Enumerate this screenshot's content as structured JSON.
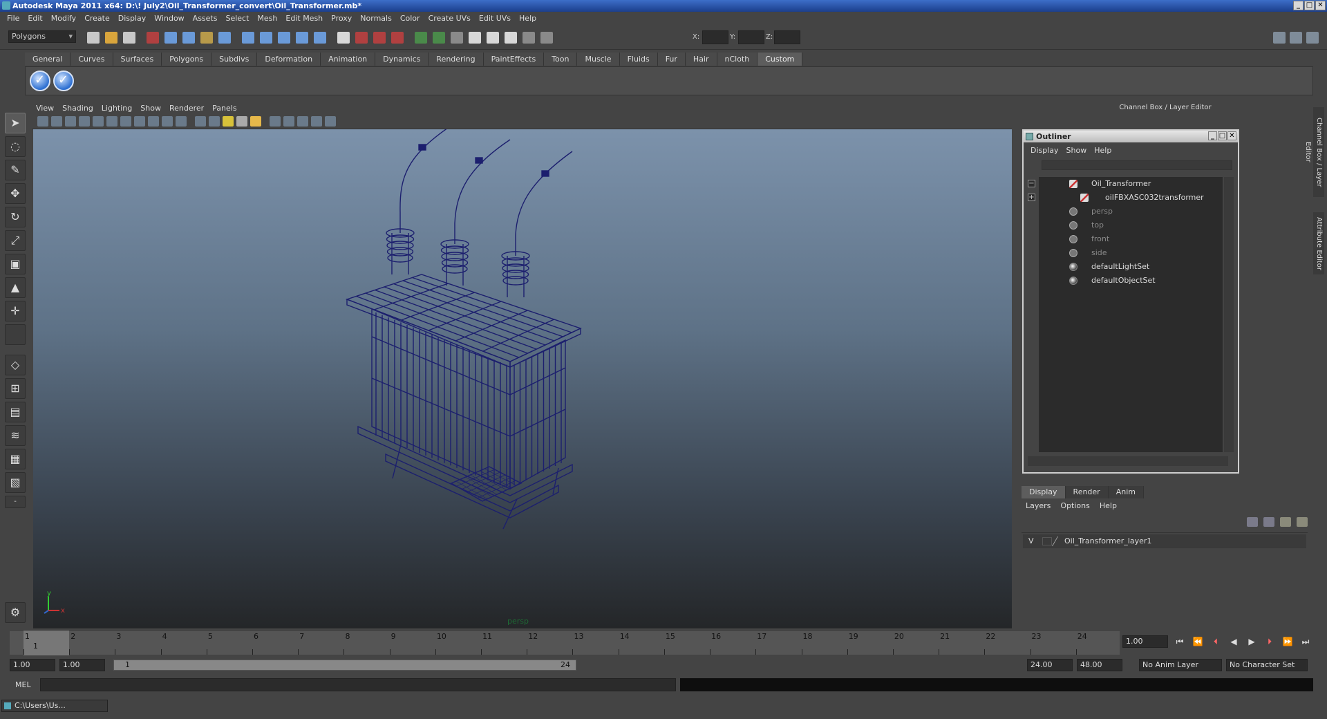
{
  "window": {
    "title": "Autodesk Maya 2011 x64: D:\\! July2\\Oil_Transformer_convert\\Oil_Transformer.mb*",
    "min": "_",
    "max": "□",
    "close": "✕"
  },
  "menubar": [
    "File",
    "Edit",
    "Modify",
    "Create",
    "Display",
    "Window",
    "Assets",
    "Select",
    "Mesh",
    "Edit Mesh",
    "Proxy",
    "Normals",
    "Color",
    "Create UVs",
    "Edit UVs",
    "Help"
  ],
  "toolbar": {
    "mode": "Polygons",
    "x_label": "X:",
    "y_label": "Y:",
    "z_label": "Z:"
  },
  "shelf_tabs": [
    "General",
    "Curves",
    "Surfaces",
    "Polygons",
    "Subdivs",
    "Deformation",
    "Animation",
    "Dynamics",
    "Rendering",
    "PaintEffects",
    "Toon",
    "Muscle",
    "Fluids",
    "Fur",
    "Hair",
    "nCloth",
    "Custom"
  ],
  "shelf_active": "Custom",
  "viewport": {
    "menu": [
      "View",
      "Shading",
      "Lighting",
      "Show",
      "Renderer",
      "Panels"
    ],
    "camera_label": "persp",
    "axis_y": "y",
    "axis_x": "x",
    "wire_color": "#1c1f6e"
  },
  "right_panel": {
    "title": "Channel Box / Layer Editor",
    "vtab_channel": "Channel Box / Layer Editor",
    "vtab_attr": "Attribute Editor"
  },
  "outliner": {
    "title": "Outliner",
    "menu": [
      "Display",
      "Show",
      "Help"
    ],
    "items": [
      {
        "label": "Oil_Transformer",
        "expander": "−"
      },
      {
        "label": "oilFBXASC032transformer",
        "expander": "+"
      },
      {
        "label": "persp"
      },
      {
        "label": "top"
      },
      {
        "label": "front"
      },
      {
        "label": "side"
      },
      {
        "label": "defaultLightSet"
      },
      {
        "label": "defaultObjectSet"
      }
    ]
  },
  "layer_editor": {
    "tabs": [
      "Display",
      "Render",
      "Anim"
    ],
    "menu": [
      "Layers",
      "Options",
      "Help"
    ],
    "layer": {
      "visible": "V",
      "name": "Oil_Transformer_layer1"
    }
  },
  "timeline": {
    "ticks": [
      "1",
      "2",
      "3",
      "4",
      "5",
      "6",
      "7",
      "8",
      "9",
      "10",
      "11",
      "12",
      "13",
      "14",
      "15",
      "16",
      "17",
      "18",
      "19",
      "20",
      "21",
      "22",
      "23",
      "24"
    ],
    "current_label": "1",
    "current_frame": "1.00"
  },
  "range": {
    "start": "1.00",
    "playback_start": "1.00",
    "slider_start": "1",
    "slider_end": "24",
    "playback_end": "24.00",
    "end": "48.00",
    "anim_layer": "No Anim Layer",
    "char_set": "No Character Set"
  },
  "cmdline": {
    "label": "MEL"
  },
  "taskbar": {
    "item": "C:\\Users\\Us..."
  }
}
